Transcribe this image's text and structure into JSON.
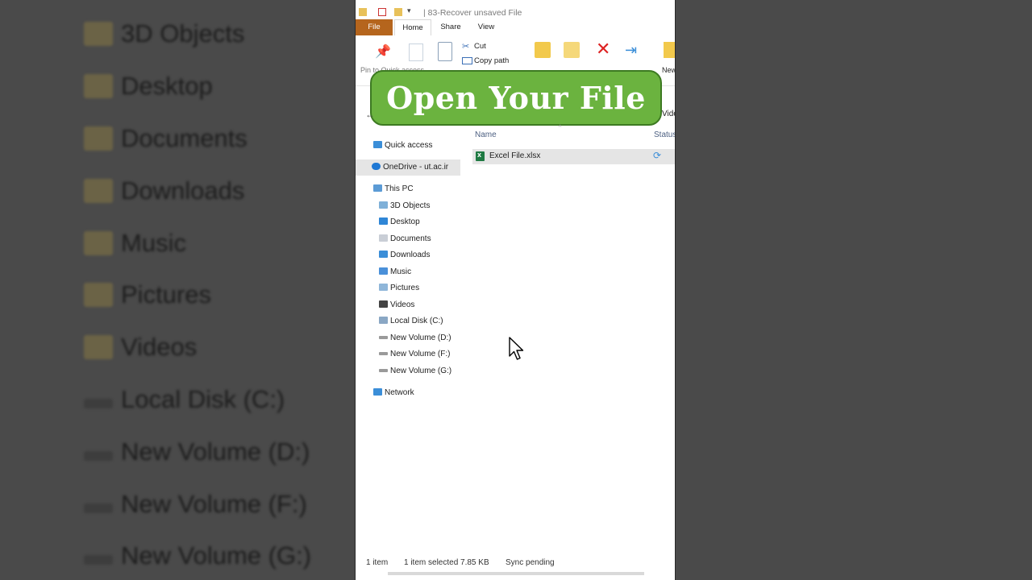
{
  "background_list": [
    "3D Objects",
    "Desktop",
    "Documents",
    "Downloads",
    "Music",
    "Pictures",
    "Videos",
    "Local Disk (C:)",
    "New Volume (D:)",
    "New Volume (F:)",
    "New Volume (G:)"
  ],
  "window": {
    "title": "| 83-Recover unsaved File",
    "tabs": {
      "file": "File",
      "home": "Home",
      "share": "Share",
      "view": "View"
    },
    "ribbon": {
      "cut": "Cut",
      "copy_path": "Copy path",
      "pin": "Pin to Quick access",
      "new_folder": "New folder"
    }
  },
  "banner": {
    "text": "Open Your File"
  },
  "address_tail": "Vide",
  "nav": {
    "quick_access": "Quick access",
    "onedrive": "OneDrive - ut.ac.ir",
    "this_pc": "This PC",
    "objects_3d": "3D Objects",
    "desktop": "Desktop",
    "documents": "Documents",
    "downloads": "Downloads",
    "music": "Music",
    "pictures": "Pictures",
    "videos": "Videos",
    "local_disk": "Local Disk (C:)",
    "vol_d": "New Volume (D:)",
    "vol_f": "New Volume (F:)",
    "vol_g": "New Volume (G:)",
    "network": "Network"
  },
  "columns": {
    "name": "Name",
    "status": "Status"
  },
  "files": [
    {
      "name": "Excel File.xlsx"
    }
  ],
  "status": {
    "count": "1 item",
    "selected": "1 item selected  7.85 KB",
    "sync": "Sync pending"
  },
  "colors": {
    "accent_file_tab": "#b5651d",
    "banner": "#6bb33f",
    "excel": "#1f7a43",
    "selection": "#e5e5e5"
  }
}
